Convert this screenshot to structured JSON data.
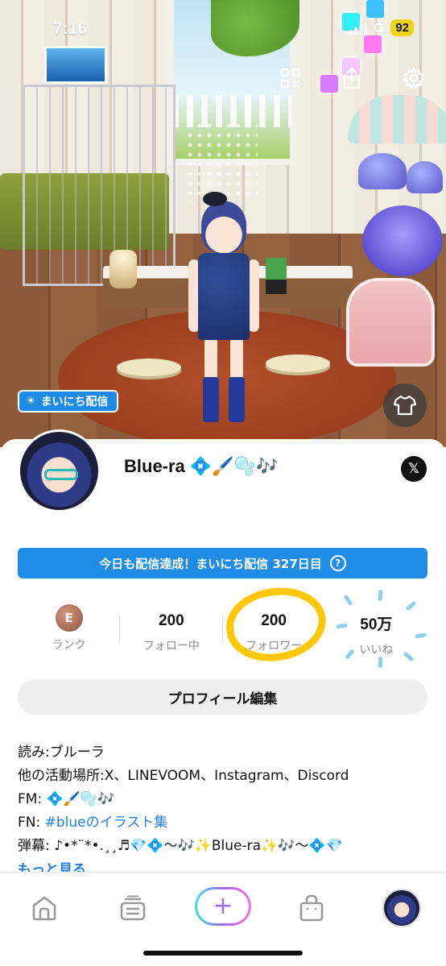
{
  "status_bar": {
    "time": "7:16",
    "network": "G",
    "battery": "92"
  },
  "room": {
    "daily_badge": "まいにち配信"
  },
  "profile": {
    "username": "Blue-ra 💠🖌️🫧🎶",
    "x_label": "𝕏"
  },
  "daily_banner": {
    "text": "今日も配信達成！まいにち配信 327日目",
    "help": "?"
  },
  "stats": {
    "rank": {
      "medal": "E",
      "label": "ランク"
    },
    "following": {
      "value": "200",
      "label": "フォロー中"
    },
    "followers": {
      "value": "200",
      "label": "フォロワー"
    },
    "likes": {
      "value": "50万",
      "label": "いいね"
    }
  },
  "edit_profile_label": "プロフィール編集",
  "bio": {
    "reading": "読み:ブルーラ",
    "activity": "他の活動場所:X、LINEVOOM、Instagram、Discord",
    "fm": "FM: 💠🖌️🫧🎶",
    "fn_prefix": "FN: ",
    "fn_link": "#blueのイラスト集",
    "danmaku": "弾幕: ♪•*¨*•.¸¸♬💎💠〜🎶✨Blue-ra✨🎶〜💠💎",
    "more": "もっと見る"
  },
  "tabbar": {
    "post": "+"
  },
  "colors": {
    "accent_blue": "#1f8ce8",
    "link_blue": "#1f7fe0",
    "highlight_yellow": "#ffc806"
  },
  "icons": [
    "qr-code-icon",
    "share-icon",
    "gear-icon",
    "sun-icon",
    "tshirt-icon",
    "home-icon",
    "feed-icon",
    "plus-icon",
    "shopping-bag-icon"
  ]
}
